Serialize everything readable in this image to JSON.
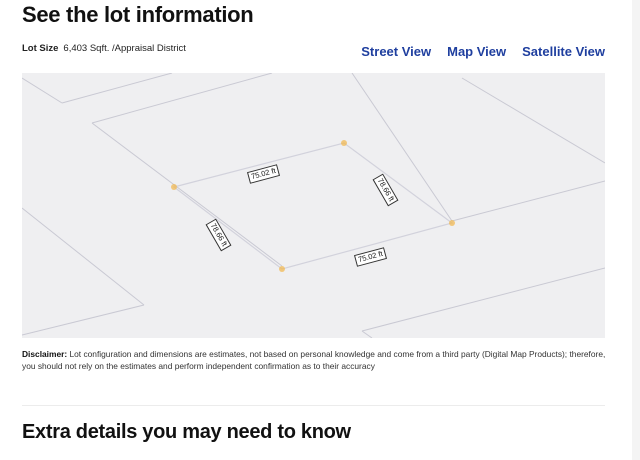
{
  "lot_section": {
    "title": "See the lot information",
    "lot_size_label": "Lot Size",
    "lot_size_value": "6,403 Sqft. /Appraisal District",
    "views": [
      "Street View",
      "Map View",
      "Satellite View"
    ]
  },
  "map": {
    "dimension_labels": [
      "75.02 ft",
      "78.66 ft",
      "78.66 ft",
      "75.02 ft"
    ],
    "colors": {
      "background": "#efeff1",
      "street_lines": "#c9c9d3",
      "lot_lines": "#d2d2dc",
      "vertex": "#f2b64a"
    }
  },
  "disclaimer": {
    "label": "Disclaimer:",
    "text": "Lot configuration and dimensions are estimates, not based on personal knowledge and come from a third party (Digital Map Products); therefore, you should not rely on the estimates and perform independent confirmation as to their accuracy"
  },
  "extra_section": {
    "title": "Extra details you may need to know"
  }
}
